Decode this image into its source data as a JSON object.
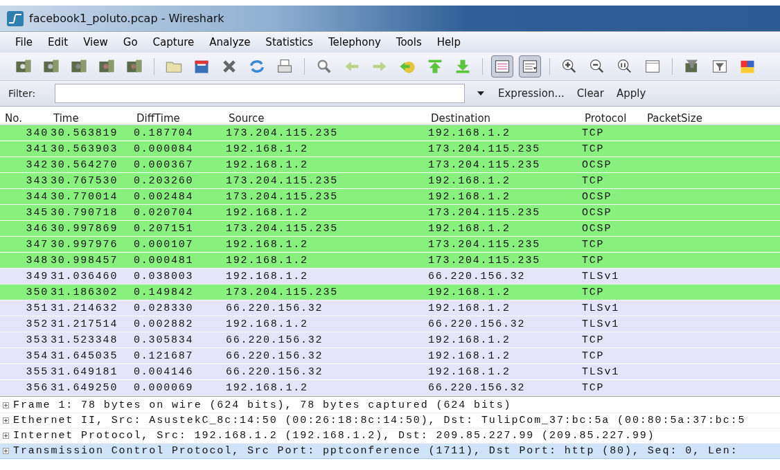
{
  "window": {
    "title": "facebook1_poluto.pcap - Wireshark"
  },
  "menu": [
    "File",
    "Edit",
    "View",
    "Go",
    "Capture",
    "Analyze",
    "Statistics",
    "Telephony",
    "Tools",
    "Help"
  ],
  "toolbar": {
    "pane_toggles": [
      {
        "pressed": true
      },
      {
        "pressed": true
      }
    ]
  },
  "filter_bar": {
    "label": "Filter:",
    "buttons": [
      "Expression...",
      "Clear",
      "Apply"
    ]
  },
  "packet_list": {
    "columns": [
      "No.",
      "Time",
      "DiffTime",
      "Source",
      "Destination",
      "Protocol",
      "PacketSize"
    ],
    "rows": [
      {
        "cells": [
          "340",
          "30.563819",
          "0.187704",
          "173.204.115.235",
          "192.168.1.2",
          "TCP"
        ],
        "color": "#88f07c"
      },
      {
        "cells": [
          "341",
          "30.563903",
          "0.000084",
          "192.168.1.2",
          "173.204.115.235",
          "TCP"
        ],
        "color": "#88f07c"
      },
      {
        "cells": [
          "342",
          "30.564270",
          "0.000367",
          "192.168.1.2",
          "173.204.115.235",
          "OCSP"
        ],
        "color": "#88f07c"
      },
      {
        "cells": [
          "343",
          "30.767530",
          "0.203260",
          "173.204.115.235",
          "192.168.1.2",
          "TCP"
        ],
        "color": "#88f07c"
      },
      {
        "cells": [
          "344",
          "30.770014",
          "0.002484",
          "173.204.115.235",
          "192.168.1.2",
          "OCSP"
        ],
        "color": "#88f07c"
      },
      {
        "cells": [
          "345",
          "30.790718",
          "0.020704",
          "192.168.1.2",
          "173.204.115.235",
          "OCSP"
        ],
        "color": "#88f07c"
      },
      {
        "cells": [
          "346",
          "30.997869",
          "0.207151",
          "173.204.115.235",
          "192.168.1.2",
          "OCSP"
        ],
        "color": "#88f07c"
      },
      {
        "cells": [
          "347",
          "30.997976",
          "0.000107",
          "192.168.1.2",
          "173.204.115.235",
          "TCP"
        ],
        "color": "#88f07c"
      },
      {
        "cells": [
          "348",
          "30.998457",
          "0.000481",
          "192.168.1.2",
          "173.204.115.235",
          "TCP"
        ],
        "color": "#88f07c"
      },
      {
        "cells": [
          "349",
          "31.036460",
          "0.038003",
          "192.168.1.2",
          "66.220.156.32",
          "TLSv1"
        ],
        "color": "#e4e4fa"
      },
      {
        "cells": [
          "350",
          "31.186302",
          "0.149842",
          "173.204.115.235",
          "192.168.1.2",
          "TCP"
        ],
        "color": "#88f07c"
      },
      {
        "cells": [
          "351",
          "31.214632",
          "0.028330",
          "66.220.156.32",
          "192.168.1.2",
          "TLSv1"
        ],
        "color": "#e4e4fa"
      },
      {
        "cells": [
          "352",
          "31.217514",
          "0.002882",
          "192.168.1.2",
          "66.220.156.32",
          "TLSv1"
        ],
        "color": "#e4e4fa"
      },
      {
        "cells": [
          "353",
          "31.523348",
          "0.305834",
          "66.220.156.32",
          "192.168.1.2",
          "TCP"
        ],
        "color": "#e4e4fa"
      },
      {
        "cells": [
          "354",
          "31.645035",
          "0.121687",
          "66.220.156.32",
          "192.168.1.2",
          "TCP"
        ],
        "color": "#e4e4fa"
      },
      {
        "cells": [
          "355",
          "31.649181",
          "0.004146",
          "66.220.156.32",
          "192.168.1.2",
          "TLSv1"
        ],
        "color": "#e4e4fa"
      },
      {
        "cells": [
          "356",
          "31.649250",
          "0.000069",
          "192.168.1.2",
          "66.220.156.32",
          "TCP"
        ],
        "color": "#e4e4fa"
      }
    ]
  },
  "details": [
    {
      "text": "Frame 1: 78 bytes on wire (624 bits), 78 bytes captured (624 bits)",
      "expanded": false,
      "selected": false
    },
    {
      "text": "Ethernet II, Src: AsustekC_8c:14:50 (00:26:18:8c:14:50), Dst: TulipCom_37:bc:5a (00:80:5a:37:bc:5",
      "expanded": false,
      "selected": false
    },
    {
      "text": "Internet Protocol, Src: 192.168.1.2 (192.168.1.2), Dst: 209.85.227.99 (209.85.227.99)",
      "expanded": false,
      "selected": false
    },
    {
      "text": "Transmission Control Protocol, Src Port: pptconference (1711), Dst Port: http (80), Seq: 0, Len:",
      "expanded": false,
      "selected": true
    }
  ]
}
